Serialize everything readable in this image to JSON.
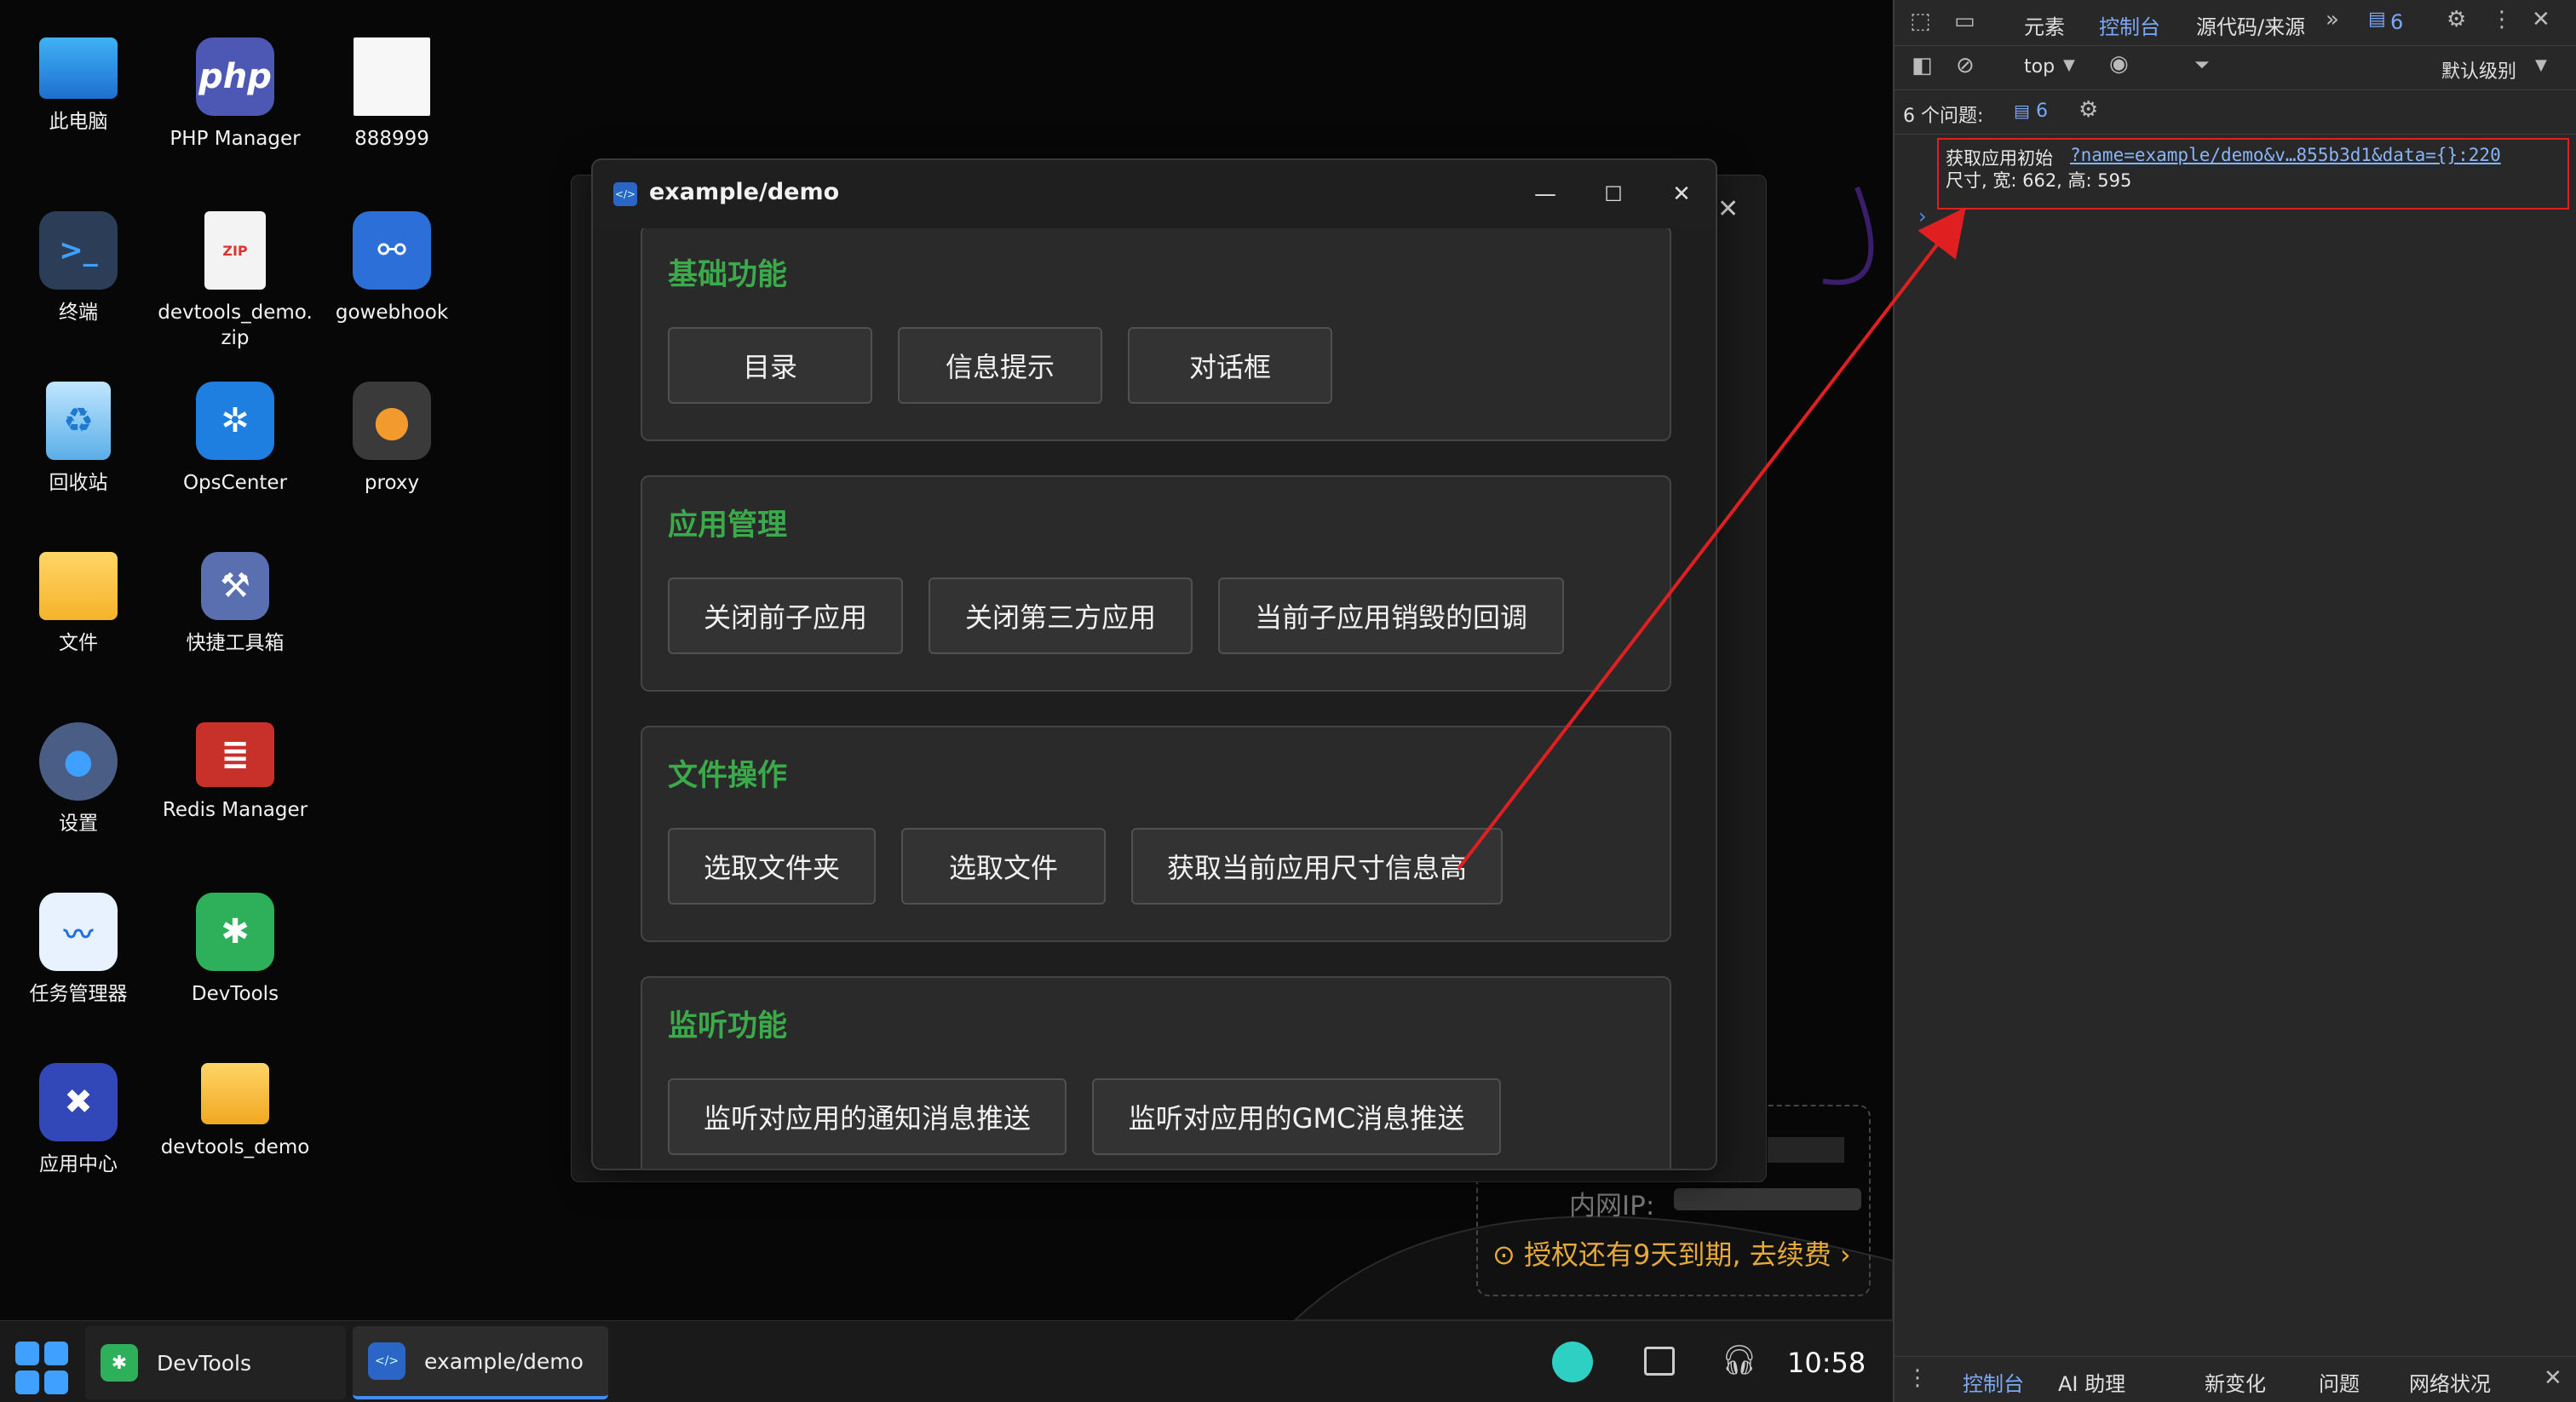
{
  "desktop": {
    "icons": [
      {
        "label": "此电脑",
        "icon": "monitor-icon"
      },
      {
        "label": "PHP Manager",
        "icon": "php-icon"
      },
      {
        "label": "888999",
        "icon": "document-thumbnail-icon"
      },
      {
        "label": "终端",
        "icon": "terminal-icon"
      },
      {
        "label": "devtools_demo.zip",
        "icon": "zip-file-icon"
      },
      {
        "label": "gowebhook",
        "icon": "webhook-icon"
      },
      {
        "label": "回收站",
        "icon": "recycle-bin-icon"
      },
      {
        "label": "OpsCenter",
        "icon": "network-hub-icon"
      },
      {
        "label": "proxy",
        "icon": "globe-icon"
      },
      {
        "label": "文件",
        "icon": "folder-icon"
      },
      {
        "label": "快捷工具箱",
        "icon": "toolbox-icon"
      },
      {
        "label": "设置",
        "icon": "gear-icon"
      },
      {
        "label": "Redis Manager",
        "icon": "redis-icon"
      },
      {
        "label": "任务管理器",
        "icon": "activity-monitor-icon"
      },
      {
        "label": "DevTools",
        "icon": "bug-icon"
      },
      {
        "label": "应用中心",
        "icon": "app-center-icon"
      },
      {
        "label": "devtools_demo",
        "icon": "folder-icon"
      }
    ],
    "license": {
      "lan_ip_label": "内网IP:",
      "notice": "⊙ 授权还有9天到期, 去续费 ›",
      "accent": "#e6a93c"
    }
  },
  "window": {
    "title": "example/demo",
    "minimize": "—",
    "maximize": "☐",
    "close": "✕",
    "back_close": "✕",
    "sections": [
      {
        "title": "基础功能",
        "buttons": [
          "目录",
          "信息提示",
          "对话框"
        ]
      },
      {
        "title": "应用管理",
        "buttons": [
          "关闭前子应用",
          "关闭第三方应用",
          "当前子应用销毁的回调"
        ]
      },
      {
        "title": "文件操作",
        "buttons": [
          "选取文件夹",
          "选取文件",
          "获取当前应用尺寸信息高"
        ]
      },
      {
        "title": "监听功能",
        "buttons": [
          "监听对应用的通知消息推送",
          "监听对应用的GMC消息推送"
        ]
      }
    ],
    "section_title_color": "#3aaa4a"
  },
  "taskbar": {
    "items": [
      {
        "label": "DevTools",
        "icon": "bug-icon"
      },
      {
        "label": "example/demo",
        "icon": "code-icon"
      }
    ],
    "clock": "10:58"
  },
  "devtools": {
    "tabs": [
      "元素",
      "控制台",
      "源代码/来源"
    ],
    "active_tab": "控制台",
    "issue_badge": "6",
    "context": "top",
    "level": "默认级别",
    "issues_label": "6 个问题:",
    "issues_count": "6",
    "console": {
      "line1_text": "获取应用初始",
      "line1_link": "?name=example/demo&v…855b3d1&data={}:220",
      "line2_text": "尺寸, 宽: 662, 高: 595",
      "prompt": "›"
    },
    "drawer_tabs": [
      "控制台",
      "AI 助理",
      "新变化",
      "问题",
      "网络状况"
    ],
    "drawer_active": "控制台",
    "accent": "#7aa9f7"
  },
  "annotation": {
    "color": "#e02020"
  }
}
